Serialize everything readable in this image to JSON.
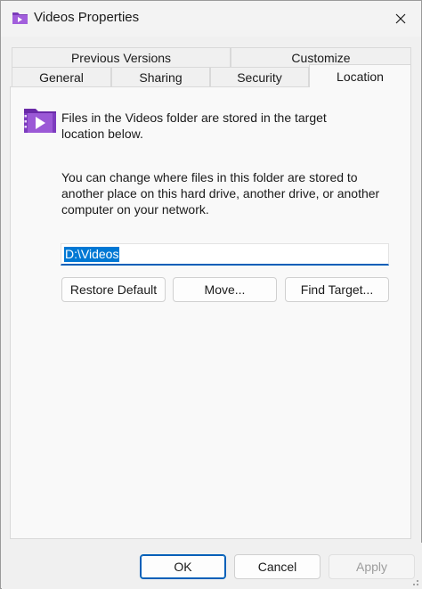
{
  "window": {
    "title": "Videos Properties",
    "close_label": "✕"
  },
  "tabs": {
    "row1": [
      {
        "label": "Previous Versions"
      },
      {
        "label": "Customize"
      }
    ],
    "row2": [
      {
        "label": "General"
      },
      {
        "label": "Sharing"
      },
      {
        "label": "Security"
      },
      {
        "label": "Location",
        "selected": true
      }
    ]
  },
  "location": {
    "info_line1": "Files in the Videos folder are stored in the target",
    "info_line2": "location below.",
    "desc_line1": "You can change where files in this folder are stored to",
    "desc_line2": "another place on this hard drive, another drive, or another",
    "desc_line3": "computer on your network.",
    "path_value": "D:\\Videos",
    "restore_default_label": "Restore Default",
    "move_label": "Move...",
    "find_target_label": "Find Target..."
  },
  "footer": {
    "ok_label": "OK",
    "cancel_label": "Cancel",
    "apply_label": "Apply"
  },
  "icons": {
    "folder": "videos-folder-icon",
    "close": "close-icon"
  },
  "colors": {
    "accent": "#005fb8",
    "selection": "#0078d4",
    "folder_purple": "#8e44c9"
  }
}
